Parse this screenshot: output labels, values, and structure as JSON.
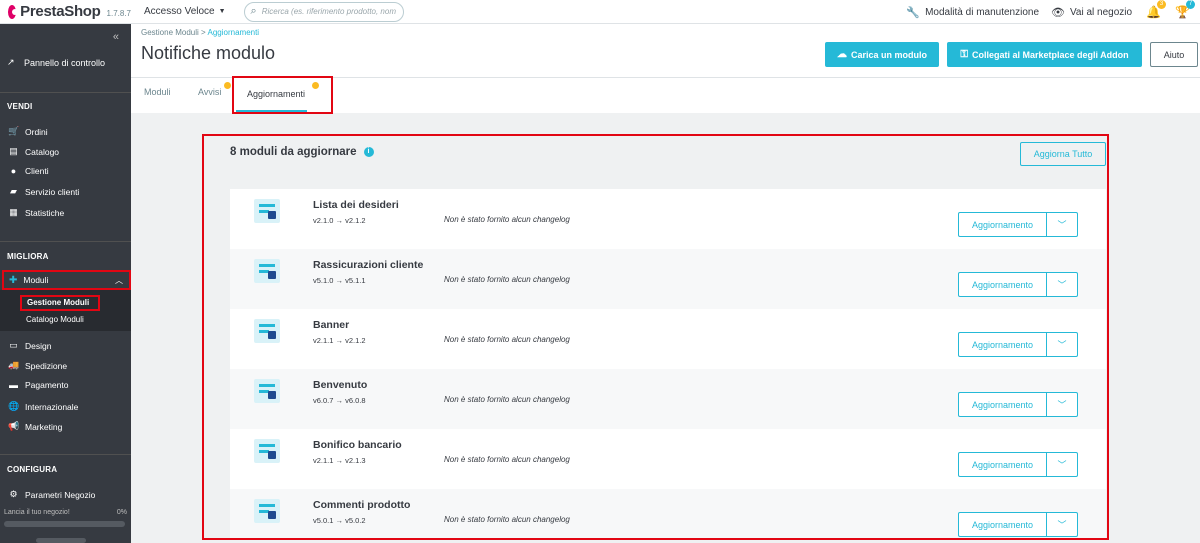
{
  "topbar": {
    "brand": "PrestaShop",
    "version": "1.7.8.7",
    "quick_access": "Accesso Veloce",
    "search_placeholder": "Ricerca (es. riferimento prodotto, nom",
    "maintenance": "Modalità di manutenzione",
    "shop": "Vai al negozio",
    "orders_badge": "3",
    "customers_badge": "7"
  },
  "sidebar": {
    "dashboard": "Pannello di controllo",
    "section_sell": "VENDI",
    "sell_items": [
      "Ordini",
      "Catalogo",
      "Clienti",
      "Servizio clienti",
      "Statistiche"
    ],
    "section_improve": "MIGLIORA",
    "modules": "Moduli",
    "modules_sub": [
      "Gestione Moduli",
      "Catalogo Moduli"
    ],
    "improve_items": [
      "Design",
      "Spedizione",
      "Pagamento",
      "Internazionale",
      "Marketing"
    ],
    "section_configure": "CONFIGURA",
    "configure_items": [
      "Parametri Negozio"
    ],
    "launch_text": "Lancia il tuo negozio!",
    "launch_percent": "0%"
  },
  "header": {
    "breadcrumb_parent": "Gestione Moduli",
    "breadcrumb_current": "Aggiornamenti",
    "title": "Notifiche modulo",
    "upload_button": "Carica un modulo",
    "marketplace_button": "Collegati al Marketplace degli Addon",
    "help_button": "Aiuto"
  },
  "tabs": {
    "modules": "Moduli",
    "alerts": "Avvisi",
    "updates": "Aggiornamenti"
  },
  "main": {
    "heading": "8 moduli da aggiornare",
    "update_all": "Aggiorna Tutto",
    "update_label": "Aggiornamento",
    "modules": [
      {
        "name": "Lista dei desideri",
        "version": "v2.1.0 → v2.1.2",
        "changelog": "Non è stato fornito alcun changelog"
      },
      {
        "name": "Rassicurazioni cliente",
        "version": "v5.1.0 → v5.1.1",
        "changelog": "Non è stato fornito alcun changelog"
      },
      {
        "name": "Banner",
        "version": "v2.1.1 → v2.1.2",
        "changelog": "Non è stato fornito alcun changelog"
      },
      {
        "name": "Benvenuto",
        "version": "v6.0.7 → v6.0.8",
        "changelog": "Non è stato fornito alcun changelog"
      },
      {
        "name": "Bonifico bancario",
        "version": "v2.1.1 → v2.1.3",
        "changelog": "Non è stato fornito alcun changelog"
      },
      {
        "name": "Commenti prodotto",
        "version": "v5.0.1 → v5.0.2",
        "changelog": "Non è stato fornito alcun changelog"
      }
    ]
  },
  "colors": {
    "accent": "#25b9d7",
    "sidebar": "#363a41",
    "highlight": "#e20613",
    "badge": "#fbbb22"
  }
}
